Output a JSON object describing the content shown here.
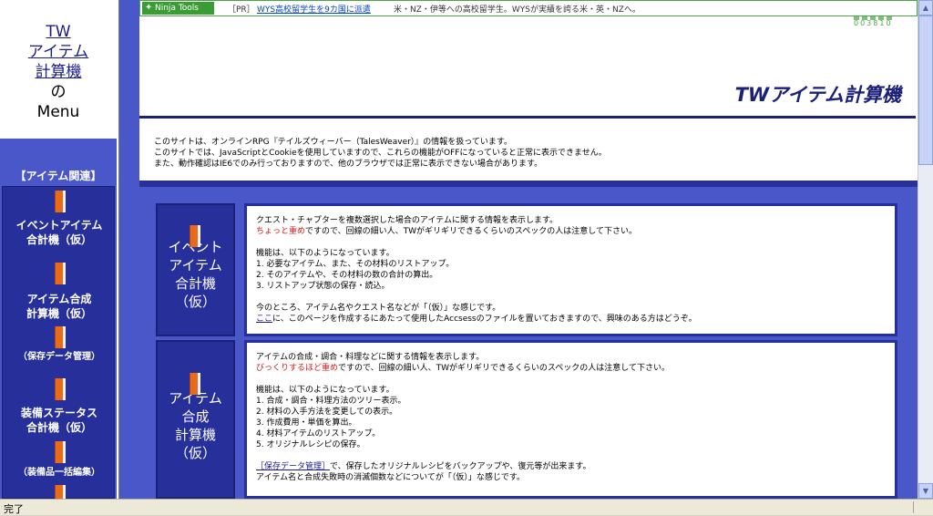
{
  "left_frame": {
    "title_lines": [
      "TW",
      "アイテム",
      "計算機"
    ],
    "plain_lines": [
      "の",
      "Menu"
    ],
    "category_header": "【アイテム関連】",
    "items": [
      {
        "lines": [
          "イベントアイテム",
          "合計機（仮）"
        ]
      },
      {
        "lines": [
          "アイテム合成",
          "計算機（仮）"
        ]
      },
      {
        "lines": [
          "（保存データ管理）"
        ]
      },
      {
        "lines": [
          "装備ステータス",
          "合計機（仮）"
        ]
      },
      {
        "lines": [
          "（装備品一括編集）"
        ]
      }
    ]
  },
  "ad_bar": {
    "ninja_label": "Ninja Tools",
    "pr_label": "［PR］",
    "link_text": "WYS高校留学生を9カ国に派遣",
    "description": "米・NZ・伊等への高校留学生。WYSが実績を誇る米・英・NZへ。",
    "counter_digits": "003810"
  },
  "header": {
    "site_title": "TWアイテム計算機",
    "notice_lines": [
      "このサイトは、オンラインRPG『テイルズウィーバー（TalesWeaver）』の情報を扱っています。",
      "このサイトでは、JavaScriptとCookieを使用していますので、これらの機能がOFFになっていると正常に表示できません。",
      "また、動作確認はIE6でのみ行っておりますので、他のブラウザでは正常に表示できない場合があります。"
    ]
  },
  "cards": [
    {
      "label_lines": [
        "イベント",
        "アイテム",
        "合計機",
        "（仮）"
      ],
      "p1": "クエスト・チャプターを複数選択した場合のアイテムに関する情報を表示します。",
      "p2_red": "ちょっと重め",
      "p2_rest": "ですので、回線の細い人、TWがギリギリできるくらいのスペックの人は注意して下さい。",
      "features_head": "機能は、以下のようになっています。",
      "features": [
        "1. 必要なアイテム、また、その材料のリストアップ。",
        "2. そのアイテムや、その材料の数の合計の算出。",
        "3. リストアップ状態の保存・読込。"
      ],
      "footer1": "今のところ、アイテム名やクエスト名などが「（仮）」な感じです。",
      "footer2_link": "ここ",
      "footer2_rest": "に、このページを作成するにあたって使用したAccsessのファイルを置いておきますので、興味のある方はどうぞ。"
    },
    {
      "label_lines": [
        "アイテム",
        "合成",
        "計算機",
        "（仮）"
      ],
      "p1": "アイテムの合成・調合・料理などに関する情報を表示します。",
      "p2_red": "びっくりするほど重め",
      "p2_rest": "ですので、回線の細い人、TWがギリギリできるくらいのスペックの人は注意して下さい。",
      "features_head": "機能は、以下のようになっています。",
      "features": [
        "1. 合成・調合・料理方法のツリー表示。",
        "2. 材料の入手方法を変更しての表示。",
        "3. 作成費用・単価を算出。",
        "4. 材料アイテムのリストアップ。",
        "5. オリジナルレシピの保存。"
      ],
      "footer1_link": "［保存データ管理］",
      "footer1_rest": "で、保存したオリジナルレシピをバックアップや、復元等が出来ます。",
      "footer2": "アイテム名と合成失敗時の消滅個数などについてが「（仮）」な感じです。"
    }
  ],
  "status_bar": {
    "text": "完了"
  },
  "colors": {
    "menu_bg": "#4a57c9",
    "panel_bg": "#27309a",
    "title_color": "#1b2178",
    "accent_orange": "#e86a1a",
    "ad_green": "#49a843"
  }
}
